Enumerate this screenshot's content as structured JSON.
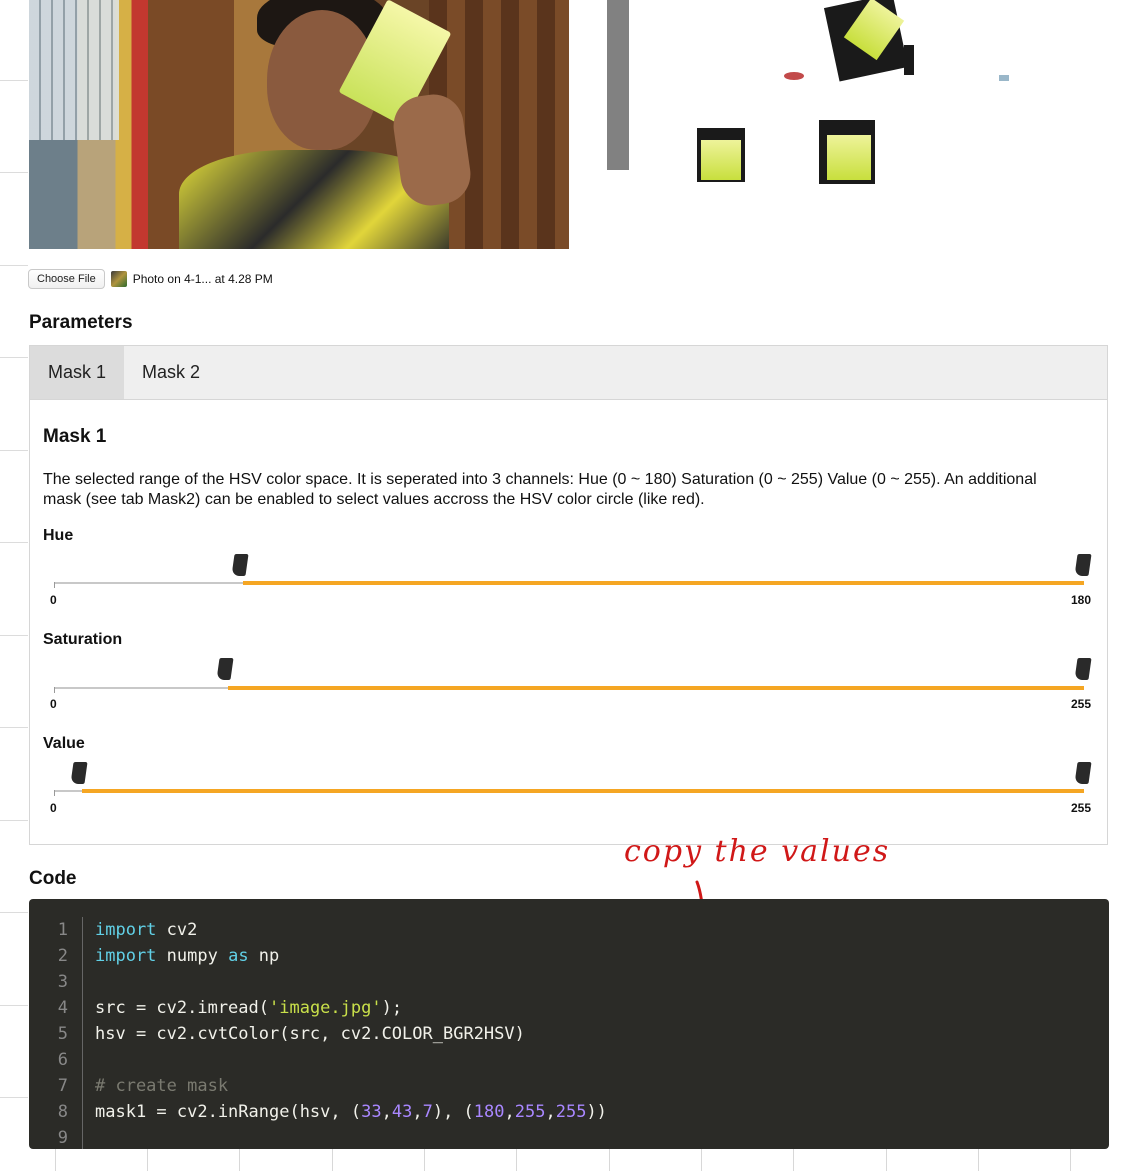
{
  "file_input": {
    "button_label": "Choose File",
    "file_name": "Photo on 4-1... at 4.28 PM"
  },
  "parameters": {
    "title": "Parameters",
    "tabs": [
      {
        "label": "Mask 1",
        "active": true
      },
      {
        "label": "Mask 2",
        "active": false
      }
    ],
    "panel_title": "Mask 1",
    "description": "The selected range of the HSV color space. It is seperated into 3 channels: Hue (0 ~ 180) Saturation (0 ~ 255) Value (0 ~ 255). An additional mask (see tab Mask2) can be enabled to select values accross the HSV color circle (like red).",
    "sliders": [
      {
        "label": "Hue",
        "min": 0,
        "max": 180,
        "low": 33,
        "high": 180,
        "min_label": "0",
        "max_label": "180"
      },
      {
        "label": "Saturation",
        "min": 0,
        "max": 255,
        "low": 43,
        "high": 255,
        "min_label": "0",
        "max_label": "255"
      },
      {
        "label": "Value",
        "min": 0,
        "max": 255,
        "low": 7,
        "high": 255,
        "min_label": "0",
        "max_label": "255"
      }
    ],
    "accent_color": "#f5a623"
  },
  "code": {
    "title": "Code",
    "line_numbers": [
      "1",
      "2",
      "3",
      "4",
      "5",
      "6",
      "7",
      "8",
      "9"
    ],
    "lines": [
      [
        {
          "t": "import",
          "c": "kw"
        },
        {
          "t": " cv2",
          "c": ""
        }
      ],
      [
        {
          "t": "import",
          "c": "kw"
        },
        {
          "t": " numpy ",
          "c": ""
        },
        {
          "t": "as",
          "c": "kw"
        },
        {
          "t": " np",
          "c": ""
        }
      ],
      [],
      [
        {
          "t": "src = cv2.imread(",
          "c": ""
        },
        {
          "t": "'image.jpg'",
          "c": "str"
        },
        {
          "t": ");",
          "c": ""
        }
      ],
      [
        {
          "t": "hsv = cv2.cvtColor(src, cv2.COLOR_BGR2HSV)",
          "c": ""
        }
      ],
      [],
      [
        {
          "t": "# create mask",
          "c": "cmt"
        }
      ],
      [
        {
          "t": "mask1 = cv2.inRange(hsv, (",
          "c": ""
        },
        {
          "t": "33",
          "c": "num"
        },
        {
          "t": ",",
          "c": ""
        },
        {
          "t": "43",
          "c": "num"
        },
        {
          "t": ",",
          "c": ""
        },
        {
          "t": "7",
          "c": "num"
        },
        {
          "t": "), (",
          "c": ""
        },
        {
          "t": "180",
          "c": "num"
        },
        {
          "t": ",",
          "c": ""
        },
        {
          "t": "255",
          "c": "num"
        },
        {
          "t": ",",
          "c": ""
        },
        {
          "t": "255",
          "c": "num"
        },
        {
          "t": "))",
          "c": ""
        }
      ],
      []
    ]
  },
  "annotation": {
    "text": "copy the values",
    "color": "#d01818"
  }
}
